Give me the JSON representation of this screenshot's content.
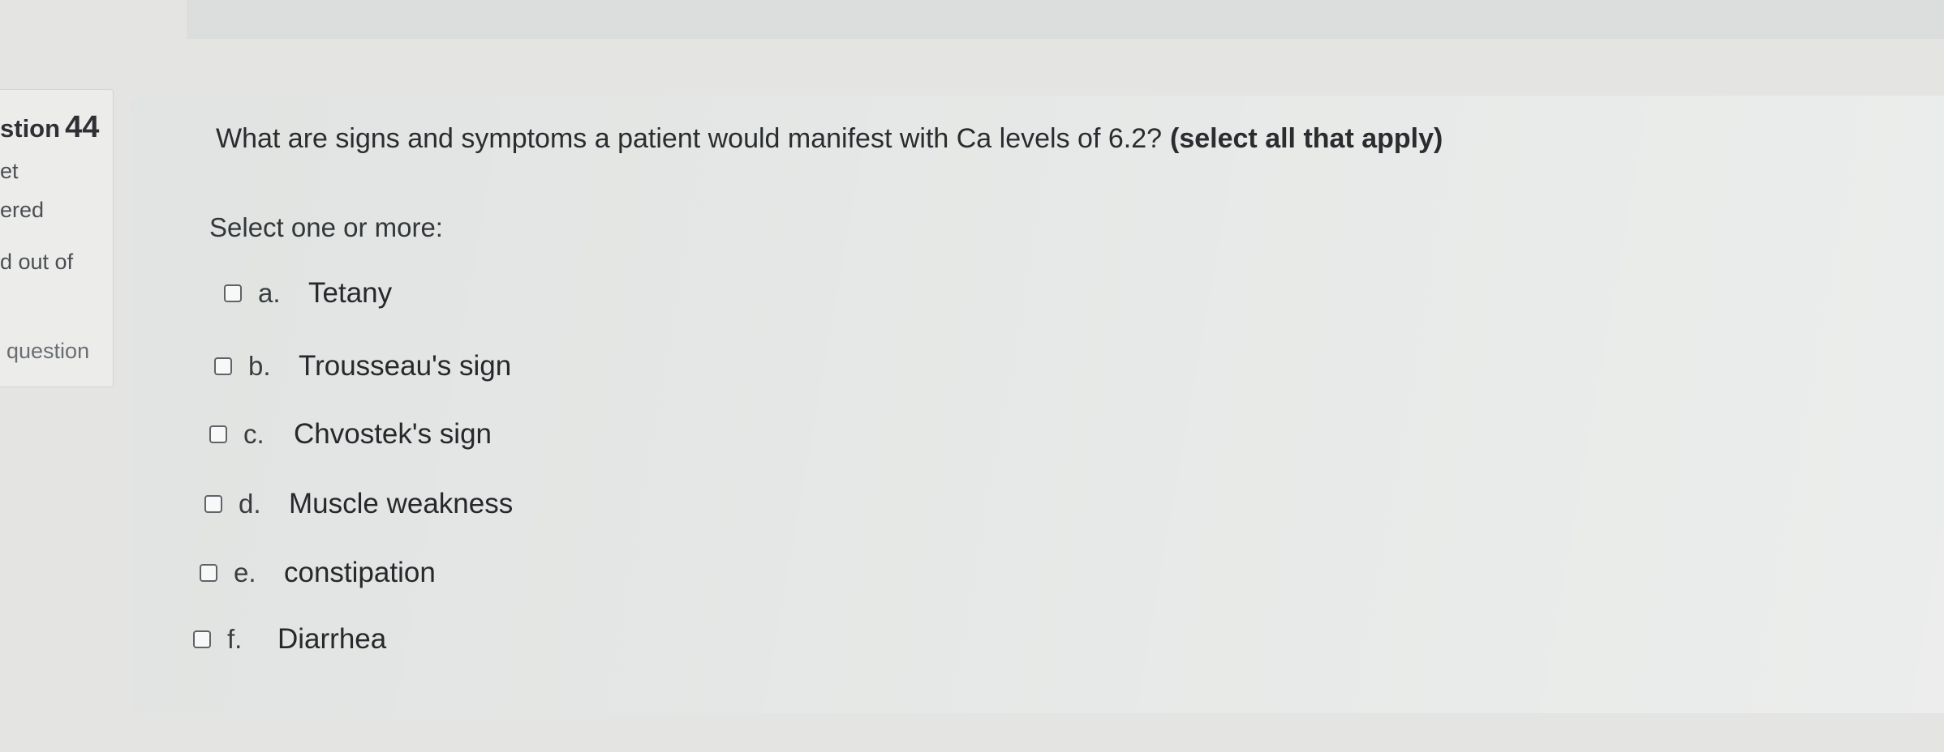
{
  "info": {
    "title_prefix": "stion",
    "number": "44",
    "line1": "et",
    "line2": "ered",
    "line3": "d out of",
    "flag": "question"
  },
  "question": {
    "text": "What are signs and symptoms a patient would manifest with Ca levels of 6.2?",
    "emphasis": "(select all that apply)",
    "prompt": "Select one or more:"
  },
  "options": [
    {
      "letter": "a.",
      "text": "Tetany",
      "checked": false
    },
    {
      "letter": "b.",
      "text": "Trousseau's sign",
      "checked": false
    },
    {
      "letter": "c.",
      "text": "Chvostek's sign",
      "checked": false
    },
    {
      "letter": "d.",
      "text": "Muscle weakness",
      "checked": false
    },
    {
      "letter": "e.",
      "text": "constipation",
      "checked": false
    },
    {
      "letter": "f.",
      "text": "Diarrhea",
      "checked": false
    }
  ]
}
